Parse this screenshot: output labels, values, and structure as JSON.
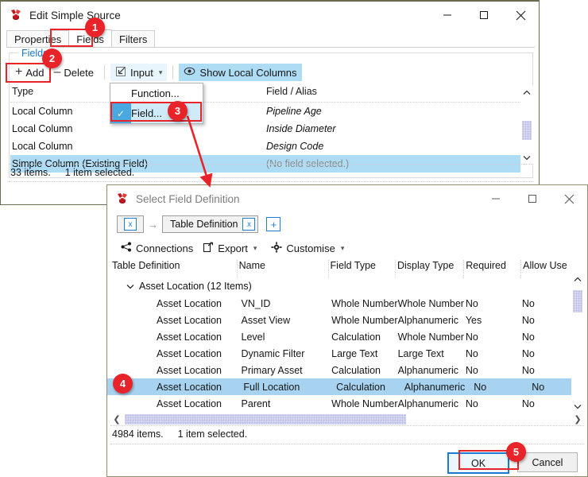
{
  "colors": {
    "accent_red": "#e8242a",
    "selection_blue": "#a8d3f0",
    "toolbar_highlight": "#aedcf5",
    "link_blue": "#1878c8",
    "focus_border": "#1a7ad4"
  },
  "window1": {
    "title": "Edit Simple Source",
    "logo_icon": "app-logo-icon",
    "controls": {
      "minimize": "minimize-icon",
      "maximize": "maximize-icon",
      "close": "close-icon"
    },
    "tabs": [
      {
        "label": "Properties",
        "active": false
      },
      {
        "label": "Fields",
        "active": true
      },
      {
        "label": "Filters",
        "active": false
      }
    ],
    "group_label": "Fields",
    "toolbar": {
      "add_label": "Add",
      "add_icon": "plus-icon",
      "delete_label": "Delete",
      "delete_icon": "minus-icon",
      "input_label": "Input",
      "input_icon": "input-arrow-icon",
      "input_caret": "chevron-down-icon",
      "show_local_columns_label": "Show Local Columns",
      "show_local_columns_icon": "eye-icon"
    },
    "dropdown": {
      "items": [
        {
          "label": "Function...",
          "checked": false
        },
        {
          "label": "Field...",
          "checked": true
        }
      ],
      "check_glyph": "check-icon"
    },
    "list": {
      "headers": [
        "Type",
        "Field / Alias"
      ],
      "rows": [
        {
          "type": "Local Column",
          "field": "Pipeline Age",
          "selected": false
        },
        {
          "type": "Local Column",
          "field": "Inside Diameter",
          "selected": false
        },
        {
          "type": "Local Column",
          "field": "Design Code",
          "selected": false
        },
        {
          "type": "Simple Column (Existing Field)",
          "field": "(No field selected.)",
          "selected": true
        }
      ]
    },
    "status": {
      "items": "33 items.",
      "selected": "1 item selected."
    },
    "scrollbar": {
      "up": "scroll-up-icon",
      "down": "scroll-down-icon"
    }
  },
  "window2": {
    "title": "Select Field Definition",
    "logo_icon": "app-logo-icon",
    "controls": {
      "minimize": "minimize-icon",
      "maximize": "maximize-icon",
      "close": "close-icon"
    },
    "breadcrumb": {
      "root_close": "x",
      "arrow": "→",
      "crumb_label": "Table Definition",
      "crumb_close": "x",
      "add_label": "+"
    },
    "toolbar": {
      "connections_label": "Connections",
      "connections_icon": "connections-icon",
      "export_label": "Export",
      "export_icon": "export-icon",
      "export_caret": "chevron-down-icon",
      "customise_label": "Customise",
      "customise_icon": "gear-icon",
      "customise_caret": "chevron-down-icon"
    },
    "table": {
      "headers": [
        "Table Definition",
        "Name",
        "Field Type",
        "Display Type",
        "Required",
        "Allow Use"
      ],
      "group_row": {
        "expander": "chevron-down-icon",
        "label": "Asset Location (12 Items)"
      },
      "rows": [
        {
          "cells": [
            "Asset Location",
            "VN_ID",
            "Whole Number",
            "Whole Number",
            "No",
            "No"
          ],
          "selected": false
        },
        {
          "cells": [
            "Asset Location",
            "Asset View",
            "Whole Number",
            "Alphanumeric",
            "Yes",
            "No"
          ],
          "selected": false
        },
        {
          "cells": [
            "Asset Location",
            "Level",
            "Calculation",
            "Whole Number",
            "No",
            "No"
          ],
          "selected": false
        },
        {
          "cells": [
            "Asset Location",
            "Dynamic Filter",
            "Large Text",
            "Large Text",
            "No",
            "No"
          ],
          "selected": false
        },
        {
          "cells": [
            "Asset Location",
            "Primary Asset",
            "Calculation",
            "Alphanumeric",
            "No",
            "No"
          ],
          "selected": false
        },
        {
          "cells": [
            "Asset Location",
            "Full Location",
            "Calculation",
            "Alphanumeric",
            "No",
            "No"
          ],
          "selected": true
        },
        {
          "cells": [
            "Asset Location",
            "Parent",
            "Whole Number",
            "Alphanumeric",
            "No",
            "No"
          ],
          "selected": false
        }
      ]
    },
    "scrollbar": {
      "up": "scroll-up-icon",
      "down": "scroll-down-icon",
      "left": "scroll-left-icon",
      "right": "scroll-right-icon"
    },
    "status": {
      "items": "4984 items.",
      "selected": "1 item selected."
    },
    "buttons": {
      "ok": "OK",
      "cancel": "Cancel"
    }
  },
  "annotations": {
    "steps": [
      {
        "number": "1",
        "target": "fields-tab"
      },
      {
        "number": "2",
        "target": "add-button"
      },
      {
        "number": "3",
        "target": "field-menu-item"
      },
      {
        "number": "4",
        "target": "full-location-row"
      },
      {
        "number": "5",
        "target": "ok-button"
      }
    ]
  }
}
